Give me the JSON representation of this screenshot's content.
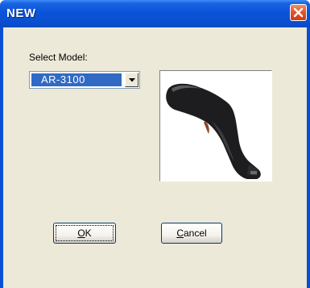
{
  "window": {
    "title": "NEW"
  },
  "form": {
    "select_label": "Select Model:",
    "selected_model": "AR-3100"
  },
  "buttons": {
    "ok_accel": "O",
    "ok_rest": "K",
    "cancel_accel": "C",
    "cancel_rest": "ancel"
  },
  "image": {
    "icon": "barcode-scanner-image"
  },
  "colors": {
    "titlebar": "#0a4fd0",
    "client": "#ece9d8",
    "selection": "#316ac5",
    "close": "#e2582f"
  }
}
